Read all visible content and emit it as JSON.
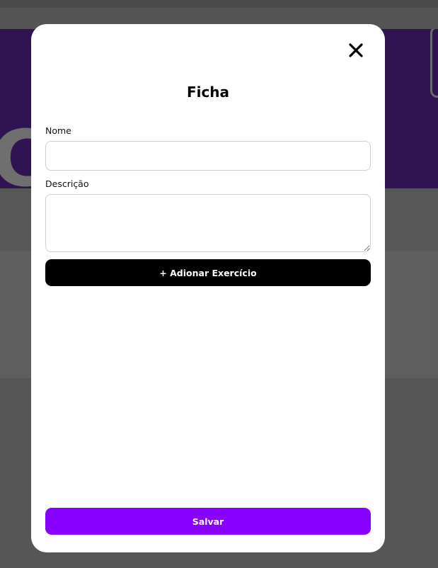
{
  "background": {
    "hero_color": "#2f1352",
    "overlay_color": "#565656"
  },
  "modal": {
    "close_icon": "close-icon",
    "title": "Ficha",
    "fields": {
      "name": {
        "label": "Nome",
        "value": "",
        "placeholder": ""
      },
      "description": {
        "label": "Descrição",
        "value": "",
        "placeholder": ""
      }
    },
    "add_exercise_label": "+ Adionar Exercício",
    "save_label": "Salvar"
  },
  "colors": {
    "primary": "#8800ff",
    "add_button": "#000000"
  }
}
